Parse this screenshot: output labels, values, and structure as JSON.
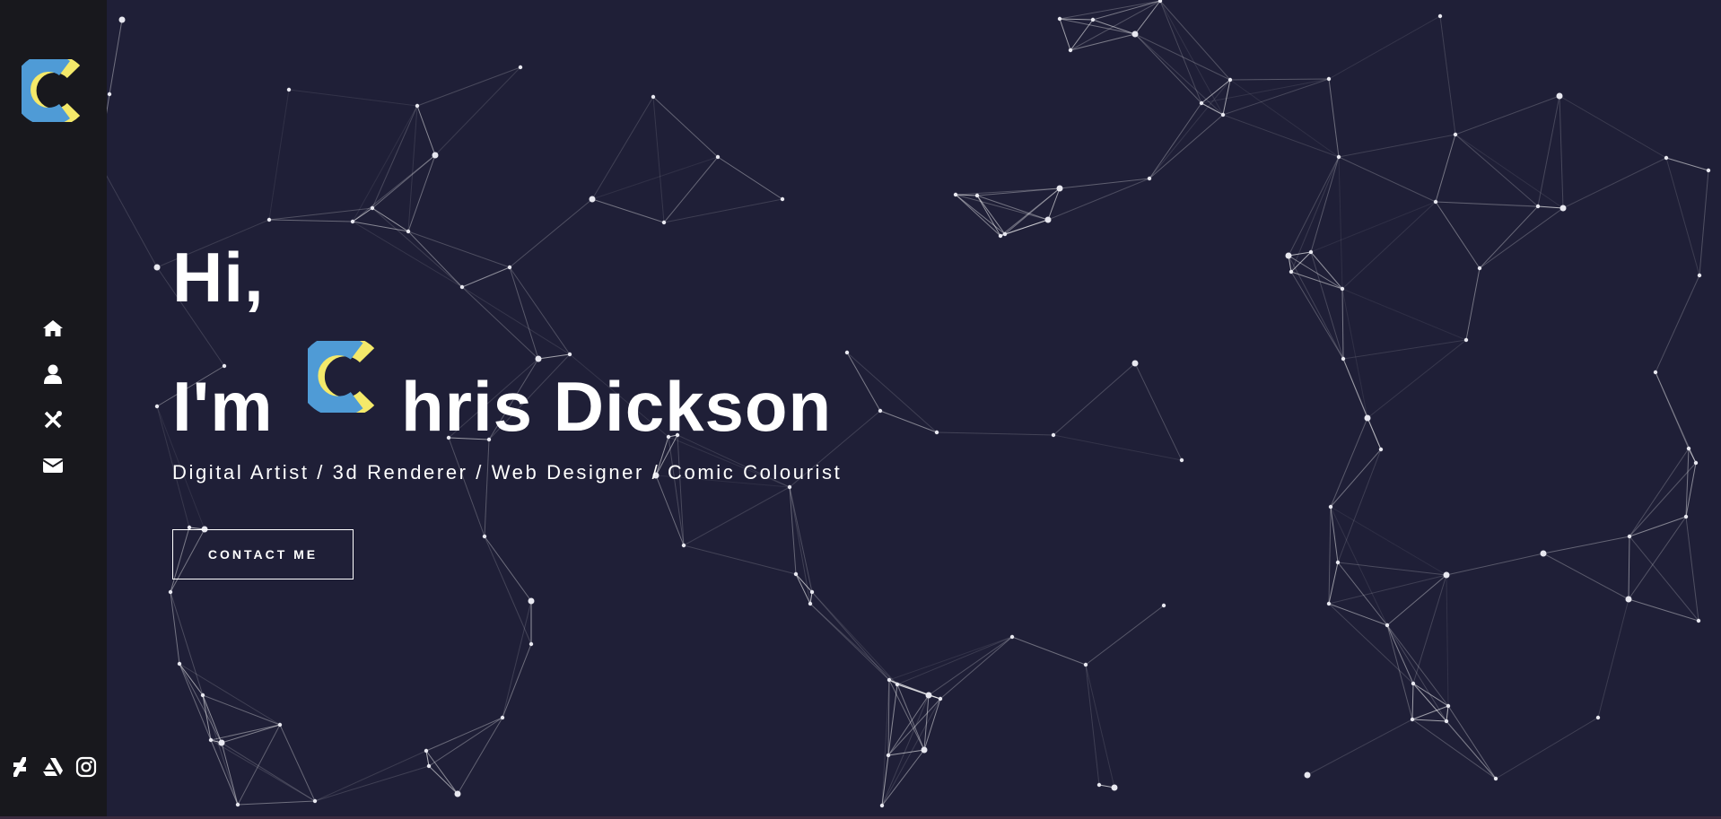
{
  "hero": {
    "greeting": "Hi,",
    "im": "I'm",
    "name_rest": "hris Dickson",
    "tagline": "Digital Artist / 3d Renderer / Web Designer / Comic Colourist",
    "cta_label": "CONTACT ME"
  },
  "sidebar": {
    "logo": "c-logo",
    "nav": [
      {
        "icon": "home-icon"
      },
      {
        "icon": "user-icon"
      },
      {
        "icon": "tools-icon"
      },
      {
        "icon": "envelope-icon"
      }
    ],
    "social": [
      {
        "icon": "deviantart-icon"
      },
      {
        "icon": "artstation-icon"
      },
      {
        "icon": "instagram-icon"
      }
    ]
  },
  "colors": {
    "background": "#1f1f37",
    "sidebar": "#18181d",
    "logo_blue": "#4f9bd6",
    "logo_yellow": "#f4e96a",
    "text": "#ffffff"
  }
}
